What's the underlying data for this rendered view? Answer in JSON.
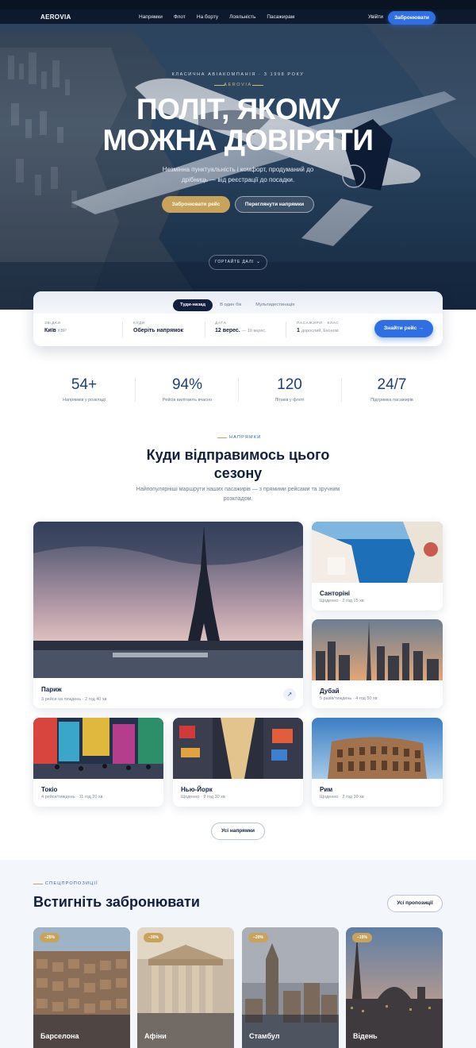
{
  "nav": {
    "logo": "AEROVIA",
    "links": [
      "Напрямки",
      "Флот",
      "На борту",
      "Лояльність",
      "Пасажирам"
    ],
    "login": "Увійти",
    "book": "Забронювати"
  },
  "hero": {
    "eyebrow": "КЛАСИЧНА АВІАКОМПАНІЯ · З 1998 РОКУ",
    "brand": "AEROVIA",
    "title_line1": "ПОЛІТ, ЯКОМУ",
    "title_line2": "МОЖНА ДОВІРЯТИ",
    "subtitle": "Незмінна пунктуальність і комфорт, продуманий до дрібниць — від реєстрації до посадки.",
    "primary_button": "Забронювати рейс",
    "secondary_button": "Переглянути напрямки",
    "scroll_label": "ГОРТАЙТЕ ДАЛІ"
  },
  "search": {
    "tabs": [
      "Туди-назад",
      "В один бік",
      "Мультидестинація"
    ],
    "active_tab": "Туди-назад",
    "from_label": "ЗВІДКИ",
    "from_value": "Київ",
    "from_code": "KBP",
    "to_label": "КУДИ",
    "to_value": "Оберіть напрямок",
    "date_label": "ДАТА",
    "date_value": "12 верес.",
    "date_return": "19 верес.",
    "pax_label": "ПАСАЖИРИ · КЛАС",
    "pax_count": "1",
    "pax_value": "дорослий, Економ",
    "button": "Знайти рейс →"
  },
  "stats": [
    {
      "value": "54+",
      "label": "Напрямків у розкладі"
    },
    {
      "value": "94%",
      "label": "Рейсів вилітають вчасно"
    },
    {
      "value": "120",
      "label": "Літаків у флоті"
    },
    {
      "value": "24/7",
      "label": "Підтримка пасажирів"
    }
  ],
  "destinations": {
    "eyebrow": "НАПРЯМКИ",
    "title_line1": "Куди відправимось цього",
    "title_line2": "сезону",
    "subtitle": "Найпопулярніші маршрути наших пасажирів — з прямими рейсами та зручним розкладом.",
    "items": [
      {
        "name": "Париж",
        "meta": "3 рейси на тиждень · 2 год 40 хв"
      },
      {
        "name": "Санторіні",
        "meta": "Щоденно · 2 год 15 хв"
      },
      {
        "name": "Дубай",
        "meta": "5 разів/тиждень · 4 год 50 хв"
      },
      {
        "name": "Токіо",
        "meta": "4 рейси/тиждень · 11 год 20 хв"
      },
      {
        "name": "Нью-Йорк",
        "meta": "Щоденно · 9 год 30 хв"
      },
      {
        "name": "Рим",
        "meta": "Щоденно · 2 год 30 хв"
      }
    ],
    "all_button": "Усі напрямки"
  },
  "offers": {
    "eyebrow": "СПЕЦПРОПОЗИЦІЇ",
    "title": "Встигніть забронювати",
    "all_button": "Усі пропозиції",
    "items": [
      {
        "name": "Барселона",
        "badge": "−25%"
      },
      {
        "name": "Афіни",
        "badge": "−30%"
      },
      {
        "name": "Стамбул",
        "badge": "−20%"
      },
      {
        "name": "Відень",
        "badge": "−15%"
      }
    ]
  },
  "colors": {
    "accent_blue": "#2f6fe4",
    "gold": "#c9a35c",
    "navy": "#12203d",
    "stat_blue": "#1d3f7a"
  }
}
